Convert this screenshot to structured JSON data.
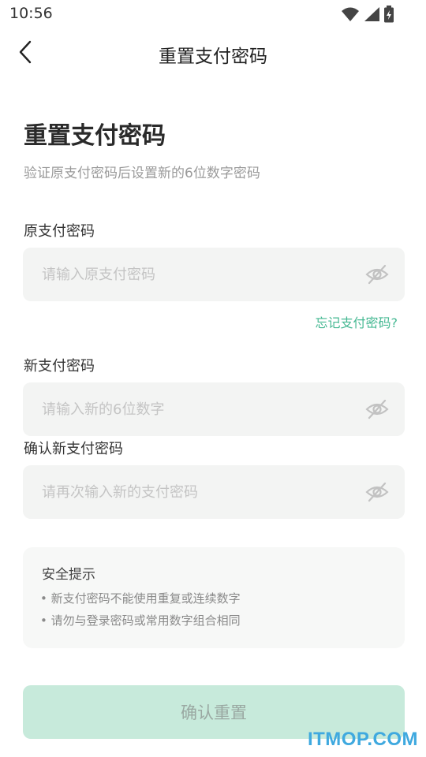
{
  "status_bar": {
    "time": "10:56",
    "icons": [
      "wifi-icon",
      "signal-icon",
      "battery-icon"
    ]
  },
  "nav": {
    "back_icon": "chevron-left-icon",
    "title": "重置支付密码"
  },
  "header": {
    "title": "重置支付密码",
    "subtitle": "验证原支付密码后设置新的6位数字密码"
  },
  "fields": {
    "old": {
      "label": "原支付密码",
      "value": "",
      "placeholder": "请输入原支付密码",
      "toggle_icon": "eye-off-icon"
    },
    "forgot": "忘记支付密码?",
    "new": {
      "label": "新支付密码",
      "value": "",
      "placeholder": "请输入新的6位数字",
      "toggle_icon": "eye-off-icon"
    },
    "confirm": {
      "label": "确认新支付密码",
      "value": "",
      "placeholder": "请再次输入新的支付密码",
      "toggle_icon": "eye-off-icon"
    }
  },
  "tips": {
    "title": "安全提示",
    "items": [
      "• 新支付密码不能使用重复或连续数字",
      "• 请勿与登录密码或常用数字组合相同"
    ]
  },
  "submit": {
    "label": "确认重置",
    "enabled": false
  },
  "watermark": "ITMOP.COM",
  "colors": {
    "accent": "#45b892",
    "button_disabled_bg": "#c7eadb",
    "input_bg": "#f3f4f3",
    "watermark": "#3fa9df"
  }
}
